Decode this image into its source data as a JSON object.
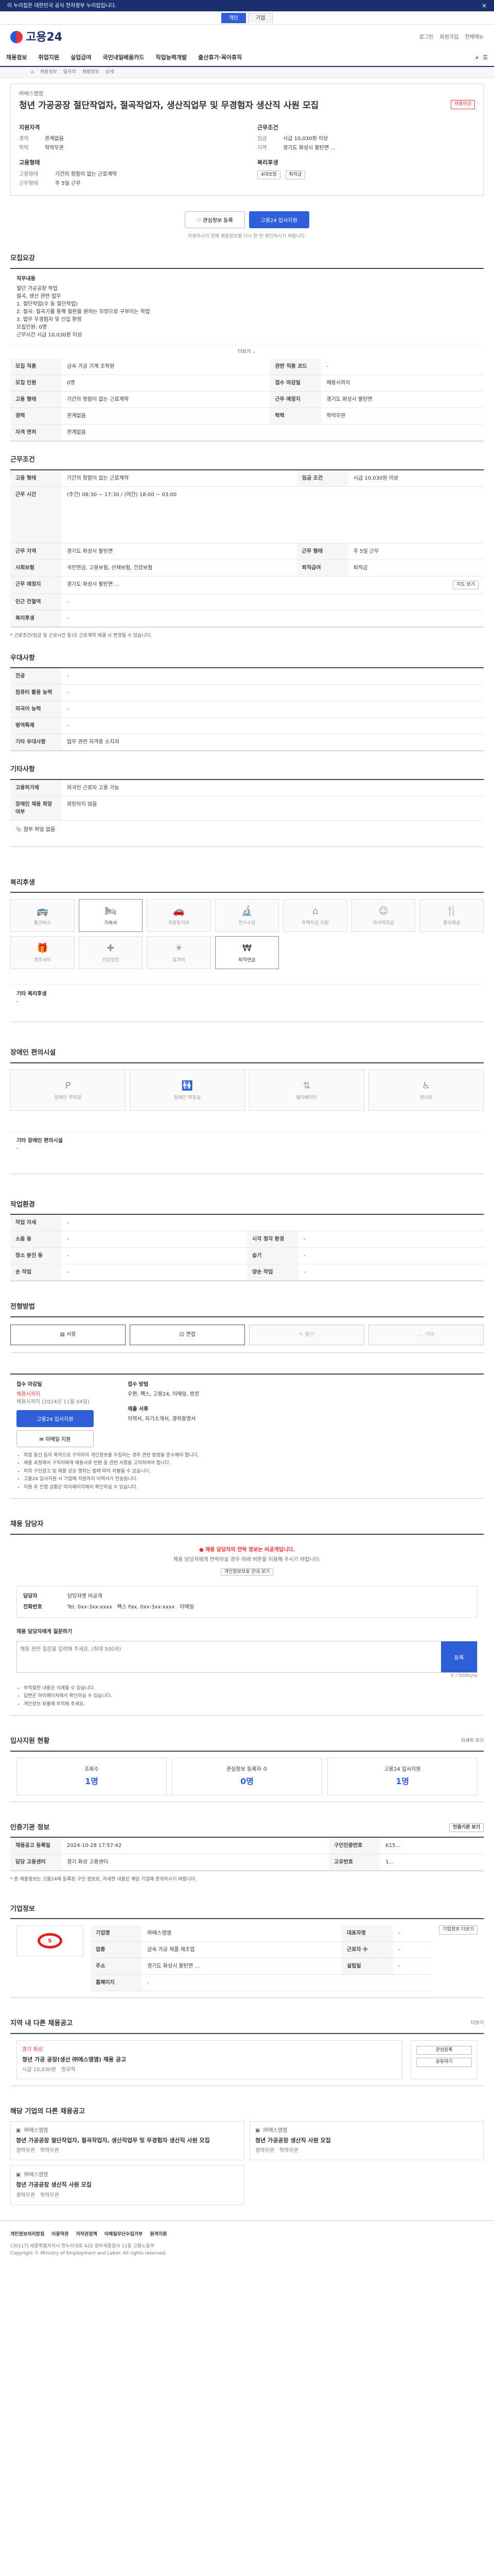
{
  "topbar": {
    "notice": "이 누리집은 대한민국 공식 전자정부 누리집입니다."
  },
  "gov_tabs": [
    "개인",
    "기업"
  ],
  "site": {
    "logo": "고용24",
    "header_links": [
      "로그인",
      "회원가입",
      "전체메뉴"
    ]
  },
  "gnb": [
    "채용정보",
    "취업지원",
    "실업급여",
    "국민내일배움카드",
    "직업능력개발",
    "출산휴가·육아휴직"
  ],
  "breadcrumb": [
    "채용정보",
    "일자리",
    "채용정보",
    "상세"
  ],
  "job": {
    "company_label": "㈜에스엠엠",
    "badge": "채용마감",
    "title": "청년 가공공장 절단작업자, 절곡작업자, 생산직업무 및 무경험자 생산직 사원 모집",
    "left_head": "지원자격",
    "left_rows": [
      {
        "k": "경력",
        "v": "관계없음"
      },
      {
        "k": "학력",
        "v": "학력무관"
      }
    ],
    "right_head": "근무조건",
    "right_rows": [
      {
        "k": "임금",
        "v": "시급 10,030원 이상"
      },
      {
        "k": "지역",
        "v": "경기도 화성시 팔탄면 ..."
      }
    ],
    "emp_head": "고용형태",
    "emp_rows": [
      {
        "k": "고용형태",
        "v": "기간의 정함이 없는 근로계약"
      },
      {
        "k": "근무형태",
        "v": "주 5일 근무"
      }
    ],
    "welfare_head": "복리후생",
    "welfare_tags": [
      "4대보험",
      "퇴직금"
    ]
  },
  "actions": {
    "scrap": "관심정보 등록",
    "apply": "고용24 입사지원"
  },
  "apply_notice": "지원하시기 전에 채용정보를 다시 한 번 확인하시기 바랍니다.",
  "recruit": {
    "title": "모집요강",
    "duty_head": "직무내용",
    "duty_lines": [
      "절단 가공공장 작업",
      "절곡, 생산 관련 업무",
      "1. 절단작업(수 동 절단작업)",
      "2. 절곡: 절곡기를 통해 철판을 원하는 모양으로 구부리는 작업",
      "3. 업무 무경험자 및 신입 환영",
      "모집인원: 0명",
      "근무시간 시급 10,030원 이상"
    ],
    "expand": "더보기",
    "rows": [
      {
        "k": "모집 직종",
        "v": "금속 가공 기계 조작원",
        "k2": "관련 직종 코드",
        "v2": "-"
      },
      {
        "k": "모집 인원",
        "v": "0명",
        "k2": "접수 마감일",
        "v2": "채용시까지"
      },
      {
        "k": "고용 형태",
        "v": "기간의 정함이 없는 근로계약",
        "k2": "근무 예정지",
        "v2": "경기도 화성시 팔탄면"
      },
      {
        "k": "경력",
        "v": "관계없음",
        "k2": "학력",
        "v2": "학력무관"
      },
      {
        "k": "자격 면허",
        "v": "관계없음",
        "k2": "",
        "v2": ""
      }
    ]
  },
  "conditions": {
    "title": "근무조건",
    "rows": [
      {
        "k": "고용 형태",
        "v": "기간의 정함이 없는 근로계약",
        "k2": "임금 조건",
        "v2": "시급 10,030원 이상"
      },
      {
        "k": "근무 시간",
        "v": "(주간) 08:30 ~ 17:30 / (야간) 18:00 ~ 03:00",
        "k2": "",
        "v2": ""
      },
      {
        "k": "근무 지역",
        "v": "경기도 화성시 팔탄면",
        "k2": "근무 형태",
        "v2": "주 5일 근무"
      },
      {
        "k": "사회보험",
        "v": "국민연금, 고용보험, 산재보험, 건강보험",
        "k2": "퇴직급여",
        "v2": "퇴직금"
      },
      {
        "k": "근무 예정지",
        "v": "경기도 화성시 팔탄면 ...",
        "k2": "",
        "v2": ""
      },
      {
        "k": "인근 전철역",
        "v": "-",
        "k2": "",
        "v2": ""
      },
      {
        "k": "복리후생",
        "v": "-",
        "k2": "",
        "v2": ""
      }
    ],
    "map_button": "지도 보기",
    "footnote": "* 근로조건(임금 및 근로시간 등)은 근로계약 체결 시 변경될 수 있습니다."
  },
  "preferences": {
    "title": "우대사항",
    "rows": [
      {
        "k": "전공",
        "v": "-"
      },
      {
        "k": "컴퓨터 활용 능력",
        "v": "-"
      },
      {
        "k": "외국어 능력",
        "v": "-"
      },
      {
        "k": "병역특례",
        "v": "-"
      },
      {
        "k": "기타 우대사항",
        "v": "업무 관련 자격증 소지자"
      }
    ]
  },
  "others": {
    "title": "기타사항",
    "rows": [
      {
        "k": "고용허가제",
        "v": "외국인 근로자 고용 가능"
      },
      {
        "k": "장애인 채용 희망 여부",
        "v": "희망하지 않음"
      }
    ],
    "attach": "첨부 파일 없음"
  },
  "facilities": {
    "title": "복리후생",
    "items": [
      {
        "name": "통근버스",
        "on": false,
        "icon": "bus-icon"
      },
      {
        "name": "기숙사",
        "on": true,
        "icon": "bed-icon"
      },
      {
        "name": "차량유지비",
        "on": false,
        "icon": "car-icon"
      },
      {
        "name": "연구수당",
        "on": false,
        "icon": "research-icon"
      },
      {
        "name": "주택자금 지원",
        "on": false,
        "icon": "house-icon"
      },
      {
        "name": "자녀학자금",
        "on": false,
        "icon": "child-icon"
      },
      {
        "name": "중식제공",
        "on": false,
        "icon": "meal-icon"
      },
      {
        "name": "경조사비",
        "on": false,
        "icon": "gift-icon"
      },
      {
        "name": "건강검진",
        "on": false,
        "icon": "health-icon"
      },
      {
        "name": "휴가비",
        "on": false,
        "icon": "vacation-icon"
      },
      {
        "name": "퇴직연금",
        "on": true,
        "icon": "pension-icon"
      }
    ],
    "note_head": "기타 복리후생",
    "note": "-"
  },
  "disabled_facilities": {
    "title": "장애인 편의시설",
    "items": [
      "장애인 주차장",
      "장애인 화장실",
      "엘리베이터",
      "경사로"
    ],
    "note_head": "기타 장애인 편의시설",
    "note": "-"
  },
  "workenv": {
    "title": "작업환경",
    "rows": [
      {
        "k": "작업 자세",
        "v": "-",
        "k2": "",
        "v2": ""
      },
      {
        "k": "소음 등",
        "v": "-",
        "k2": "시각 청각 환경",
        "v2": "-"
      },
      {
        "k": "청소 분진 등",
        "v": "-",
        "k2": "습기",
        "v2": "-"
      },
      {
        "k": "손 작업",
        "v": "-",
        "k2": "양손 작업",
        "v2": "-"
      }
    ]
  },
  "selection": {
    "title": "전형방법",
    "items": [
      {
        "name": "서류",
        "on": true
      },
      {
        "name": "면접",
        "on": true
      },
      {
        "name": "필기",
        "on": false
      },
      {
        "name": "기타",
        "on": false
      }
    ]
  },
  "apply": {
    "left_lbl": "접수 마감일",
    "left_val": "채용시까지",
    "left_sub": "채용시까지 (2024년 11월 04일)",
    "apply_btn": "고용24 입사지원",
    "mail_btn": "이메일 지원",
    "method_lbl": "접수 방법",
    "method_val": "우편, 팩스, 고용24, 이메일, 방문",
    "docs_lbl": "제출 서류",
    "docs_val": "이력서, 자기소개서, 경력증명서",
    "notes": [
      "취업 알선 등의 목적으로 구직자의 개인정보를 수집하는 경우 관련 법령을 준수해야 합니다.",
      "채용 과정에서 구직자에게 채용서류 반환 등 관련 사항을 고지하여야 합니다.",
      "허위 구인광고 및 채용 강요 행위는 법에 따라 처벌될 수 있습니다.",
      "고용24 입사지원 시 기업에 지원자의 이력서가 전송됩니다.",
      "지원 후 진행 상황은 마이페이지에서 확인하실 수 있습니다."
    ]
  },
  "contact": {
    "title": "채용 담당자",
    "alert": "채용 담당자의 연락 정보는 비공개입니다.",
    "alert_sub": "채용 담당자에게 연락하실 경우 아래 버튼을 이용해 주시기 바랍니다.",
    "alert_btn": "개인정보보호 안내 보기",
    "name_lbl": "담당자",
    "name_val": "담당자명 비공개",
    "tel_lbl": "전화번호",
    "tel_val": "Tel. 0xx-3xx-xxxx",
    "fax_lbl": "팩스",
    "fax_val": "Fax. 0xx-3xx-xxxx",
    "email_lbl": "이메일",
    "qa_head": "채용 담당자에게 질문하기",
    "qa_placeholder": "채용 관련 질문을 입력해 주세요. (최대 500자)",
    "qa_btn": "등록",
    "qa_count": "0 / 500byte",
    "qa_notes": [
      "부적절한 내용은 삭제될 수 있습니다.",
      "답변은 마이페이지에서 확인하실 수 있습니다.",
      "개인정보 유출에 주의해 주세요."
    ]
  },
  "stats": {
    "title": "입사지원 현황",
    "more": "자세히 보기",
    "items": [
      {
        "label": "조회수",
        "value": "1명"
      },
      {
        "label": "관심정보 등록자 수",
        "value": "0명"
      },
      {
        "label": "고용24 입사지원",
        "value": "1명"
      }
    ]
  },
  "info": {
    "title": "인증기관 정보",
    "more": "인증기관 보기",
    "rows": [
      {
        "k": "채용공고 등록일",
        "v": "2024-10-28 17:57:42",
        "k2": "구인인증번호",
        "v2": "K15..."
      },
      {
        "k": "담당 고용센터",
        "v": "경기 화성 고용센터",
        "k2": "고유번호",
        "v2": "1..."
      }
    ],
    "footnote": "* 본 채용정보는 고용24에 등록된 구인 정보로, 자세한 내용은 해당 기업에 문의하시기 바랍니다."
  },
  "company": {
    "title": "기업정보",
    "logo_text": "S",
    "rows": [
      {
        "k": "기업명",
        "v": "㈜에스엠엠",
        "k2": "대표자명",
        "v2": "-"
      },
      {
        "k": "업종",
        "v": "금속 가공 제품 제조업",
        "k2": "근로자 수",
        "v2": "-"
      },
      {
        "k": "주소",
        "v": "경기도 화성시 팔탄면 ...",
        "k2": "설립일",
        "v2": "-"
      },
      {
        "k": "홈페이지",
        "v": "-",
        "k2": "",
        "v2": ""
      }
    ],
    "btn": "기업정보 더보기"
  },
  "similar": {
    "title": "지역 내 다른 채용공고",
    "more": "더보기",
    "card_company": "경기 화성",
    "card_title": "청년 가공 공장(생산 ㈜에스엠엠) 채용 공고",
    "card_pay": "시급 10,030원",
    "card_type": "정규직",
    "side_items": [
      "관심등록",
      "공유하기"
    ]
  },
  "other_jobs": {
    "title": "해당 기업의 다른 채용공고",
    "cards": [
      {
        "company": "㈜에스엠엠",
        "title": "청년 가공공장 절단작업자, 절곡작업자, 생산직업무 및 무경험자 생산직 사원 모집",
        "a": "경력무관",
        "b": "학력무관"
      },
      {
        "company": "㈜에스엠엠",
        "title": "청년 가공공장 생산직 사원 모집",
        "a": "경력무관",
        "b": "학력무관"
      }
    ],
    "extra_company": "㈜에스엠엠",
    "extra_title": "청년 가공공장 생산직 사원 모집",
    "extra_a": "경력무관",
    "extra_b": "학력무관"
  },
  "footer": {
    "links": [
      "개인정보처리방침",
      "이용약관",
      "저작권정책",
      "이메일무단수집거부",
      "원격지원"
    ],
    "address": "(30117) 세종특별자치시 한누리대로 422 정부세종청사 11동 고용노동부",
    "copyright": "Copyright © Ministry of Employment and Labor. All rights reserved."
  }
}
